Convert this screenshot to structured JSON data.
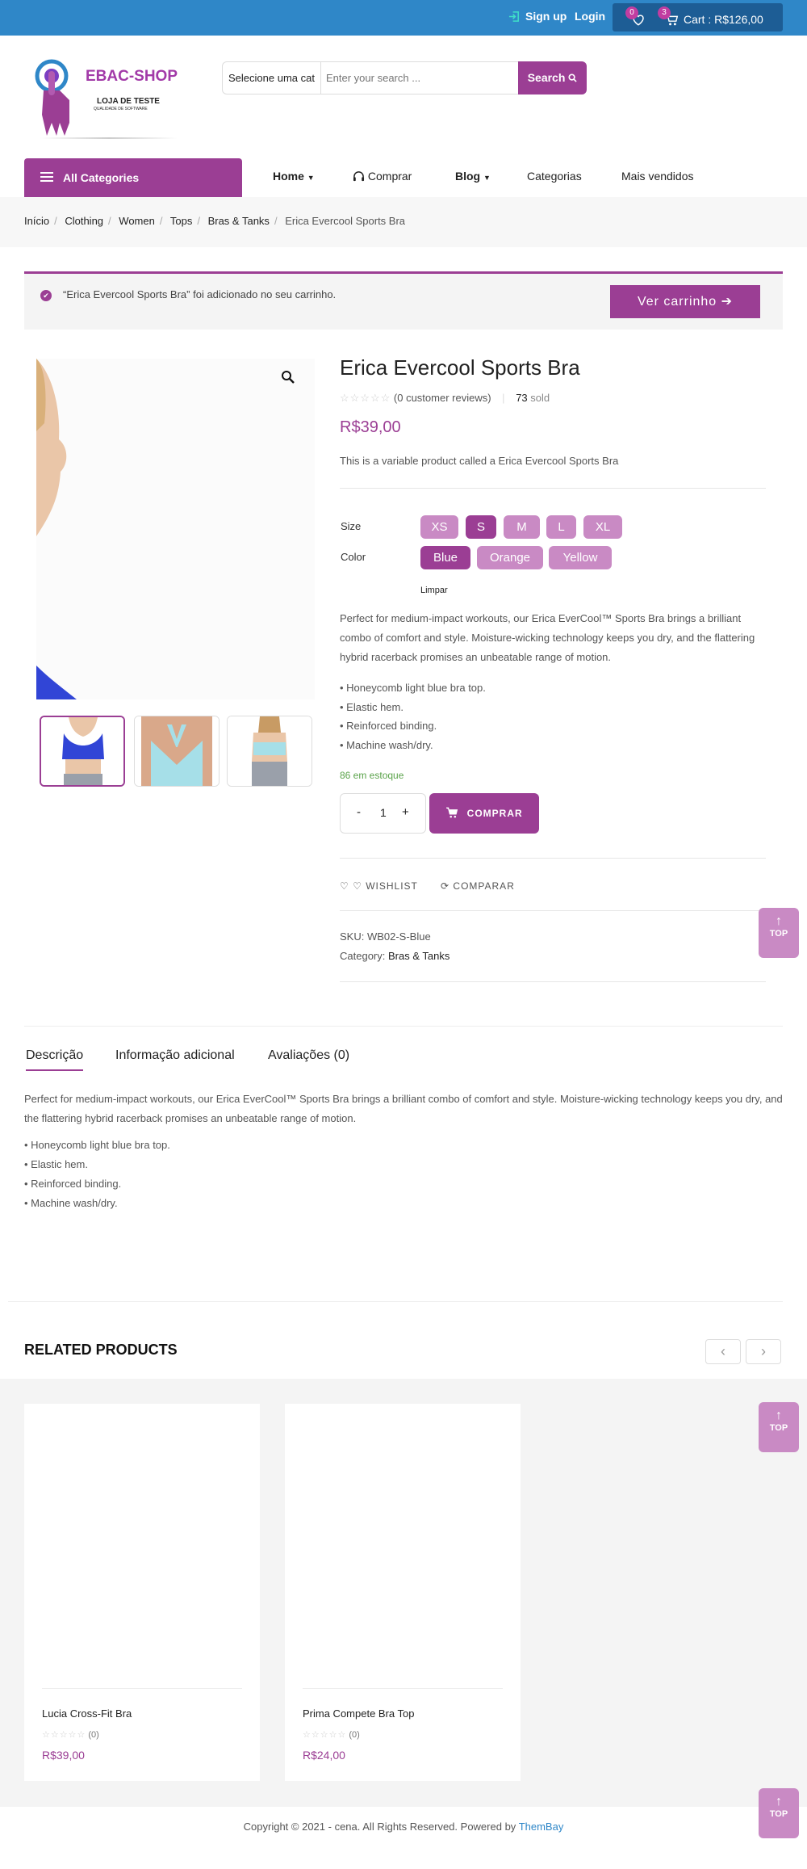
{
  "topbar": {
    "signup": "Sign up",
    "login": "Login",
    "wishlist_count": "0",
    "cart_count": "3",
    "cart_label": "Cart : R$126,00"
  },
  "logo": {
    "brand": "EBAC-SHOP",
    "line1": "LOJA DE TESTE",
    "line2": "QUALIDADE DE SOFTWARE"
  },
  "search": {
    "category": "Selecione uma cat",
    "placeholder": "Enter your search ...",
    "button": "Search"
  },
  "nav": {
    "all_categories": "All Categories",
    "items": [
      "Home",
      "Comprar",
      "Blog",
      "Categorias",
      "Mais vendidos"
    ]
  },
  "breadcrumb": [
    "Início",
    "Clothing",
    "Women",
    "Tops",
    "Bras & Tanks",
    "Erica Evercool Sports Bra"
  ],
  "notice": {
    "message": "“Erica Evercool Sports Bra” foi adicionado no seu carrinho.",
    "button": "Ver carrinho"
  },
  "product": {
    "title": "Erica Evercool Sports Bra",
    "reviews": "(0 customer reviews)",
    "sold_count": "73",
    "sold_label": "sold",
    "price": "R$39,00",
    "short_desc": "This is a variable product called a Erica Evercool Sports Bra",
    "size_label": "Size",
    "sizes": [
      "XS",
      "S",
      "M",
      "L",
      "XL"
    ],
    "selected_size": "S",
    "color_label": "Color",
    "colors": [
      "Blue",
      "Orange",
      "Yellow"
    ],
    "selected_color": "Blue",
    "clear": "Limpar",
    "description": "Perfect for medium-impact workouts, our Erica EverCool™ Sports Bra brings a brilliant combo of comfort and style. Moisture-wicking technology keeps you dry, and the flattering hybrid racerback promises an unbeatable range of motion.",
    "features": [
      "• Honeycomb light blue bra top.",
      "• Elastic hem.",
      "• Reinforced binding.",
      "• Machine wash/dry."
    ],
    "stock": "86 em estoque",
    "qty_minus": "-",
    "qty": "1",
    "qty_plus": "+",
    "buy": "COMPRAR",
    "wishlist": "WISHLIST",
    "compare": "COMPARAR",
    "sku": "SKU: WB02-S-Blue",
    "category_label": "Category:",
    "category": "Bras & Tanks"
  },
  "top_button": "TOP",
  "tabs": [
    "Descrição",
    "Informação adicional",
    "Avaliações (0)"
  ],
  "tab_content": {
    "text": "Perfect for medium-impact workouts, our Erica EverCool™ Sports Bra brings a brilliant combo of comfort and style. Moisture-wicking technology keeps you dry, and the flattering hybrid racerback promises an unbeatable range of motion.",
    "features": [
      "• Honeycomb light blue bra top.",
      "• Elastic hem.",
      "• Reinforced binding.",
      "• Machine wash/dry."
    ]
  },
  "related": {
    "title": "RELATED PRODUCTS",
    "products": [
      {
        "name": "Lucia Cross-Fit Bra",
        "rating": "(0)",
        "price": "R$39,00"
      },
      {
        "name": "Prima Compete Bra Top",
        "rating": "(0)",
        "price": "R$24,00"
      }
    ]
  },
  "footer": {
    "text": "Copyright © 2021 - cena. All Rights Reserved. Powered by",
    "link": "ThemBay"
  },
  "colors": {
    "primary": "#9b3e94",
    "swatch": "#c98ac4",
    "topbar": "#2f87c8",
    "stock": "#5aa34a"
  }
}
